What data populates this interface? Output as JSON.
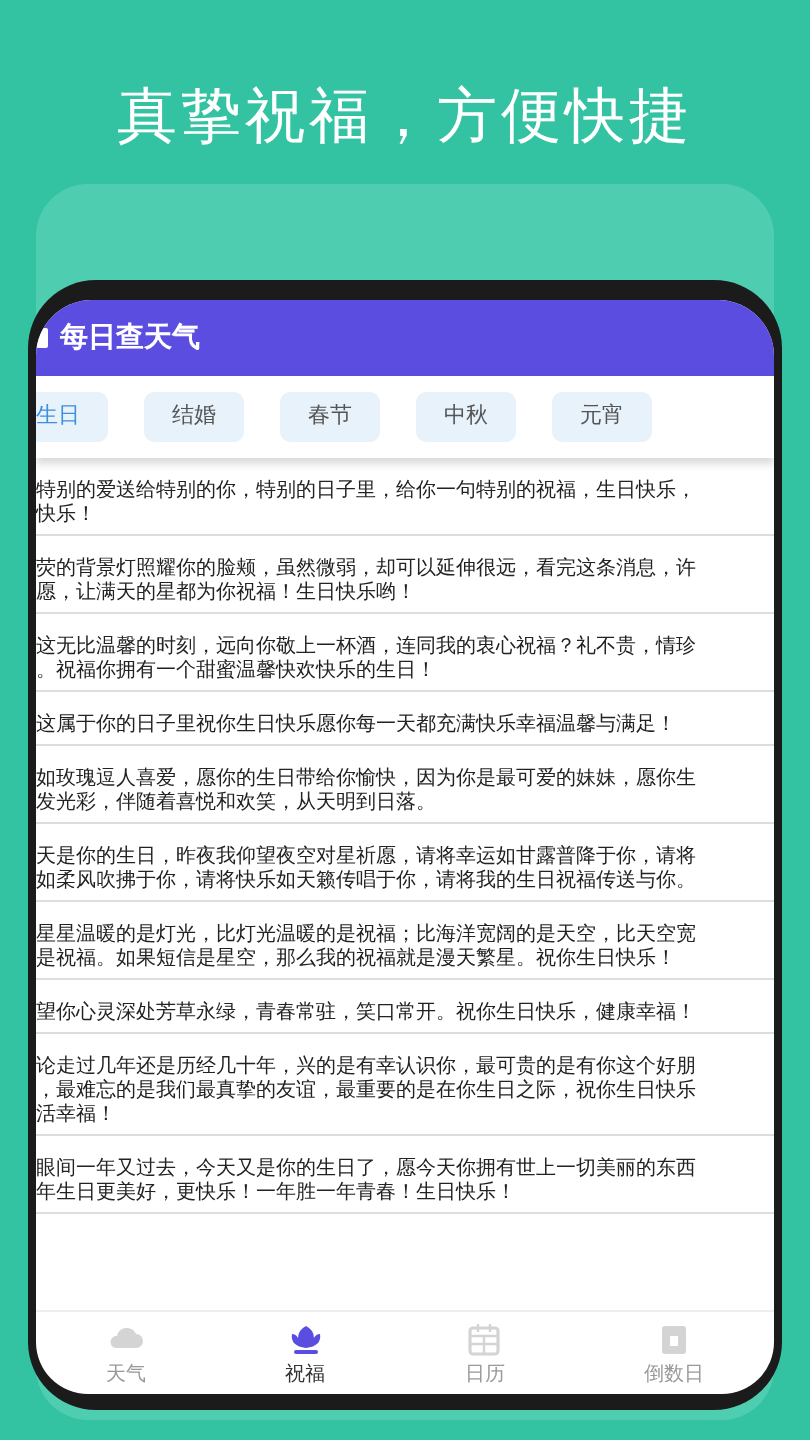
{
  "headline": "真挚祝福，方便快捷",
  "app_bar": {
    "title": "每日查天气"
  },
  "tabs": [
    {
      "label": "生日",
      "selected": true
    },
    {
      "label": "结婚",
      "selected": false
    },
    {
      "label": "春节",
      "selected": false
    },
    {
      "label": "中秋",
      "selected": false
    },
    {
      "label": "元宵",
      "selected": false
    }
  ],
  "messages": [
    {
      "lines": [
        "特别的爱送给特别的你，特别的日子里，给你一句特别的祝福，生日快乐，",
        "快乐！"
      ]
    },
    {
      "lines": [
        "荧的背景灯照耀你的脸颊，虽然微弱，却可以延伸很远，看完这条消息，许",
        "愿，让满天的星都为你祝福！生日快乐哟！"
      ]
    },
    {
      "lines": [
        "这无比温馨的时刻，远向你敬上一杯酒，连同我的衷心祝福？礼不贵，情珍",
        "。祝福你拥有一个甜蜜温馨快欢快乐的生日！"
      ]
    },
    {
      "lines": [
        "这属于你的日子里祝你生日快乐愿你每一天都充满快乐幸福温馨与满足！"
      ]
    },
    {
      "lines": [
        "如玫瑰逗人喜爱，愿你的生日带给你愉快，因为你是最可爱的妹妹，愿你生",
        "发光彩，伴随着喜悦和欢笑，从天明到日落。"
      ]
    },
    {
      "lines": [
        "天是你的生日，昨夜我仰望夜空对星祈愿，请将幸运如甘露普降于你，请将",
        "如柔风吹拂于你，请将快乐如天籁传唱于你，请将我的生日祝福传送与你。"
      ]
    },
    {
      "lines": [
        "星星温暖的是灯光，比灯光温暖的是祝福；比海洋宽阔的是天空，比天空宽",
        "是祝福。如果短信是星空，那么我的祝福就是漫天繁星。祝你生日快乐！"
      ]
    },
    {
      "lines": [
        "望你心灵深处芳草永绿，青春常驻，笑口常开。祝你生日快乐，健康幸福！"
      ]
    },
    {
      "lines": [
        "论走过几年还是历经几十年，兴的是有幸认识你，最可贵的是有你这个好朋",
        "，最难忘的是我们最真挚的友谊，最重要的是在你生日之际，祝你生日快乐",
        "活幸福！"
      ]
    },
    {
      "lines": [
        "眼间一年又过去，今天又是你的生日了，愿今天你拥有世上一切美丽的东西",
        "年生日更美好，更快乐！一年胜一年青春！生日快乐！"
      ]
    }
  ],
  "bottom_nav": [
    {
      "kind": "cloud",
      "label": "天气",
      "selected": false
    },
    {
      "kind": "lotus",
      "label": "祝福",
      "selected": true
    },
    {
      "kind": "calendar",
      "label": "日历",
      "selected": false
    },
    {
      "kind": "countdown",
      "label": "倒数日",
      "selected": false
    }
  ]
}
